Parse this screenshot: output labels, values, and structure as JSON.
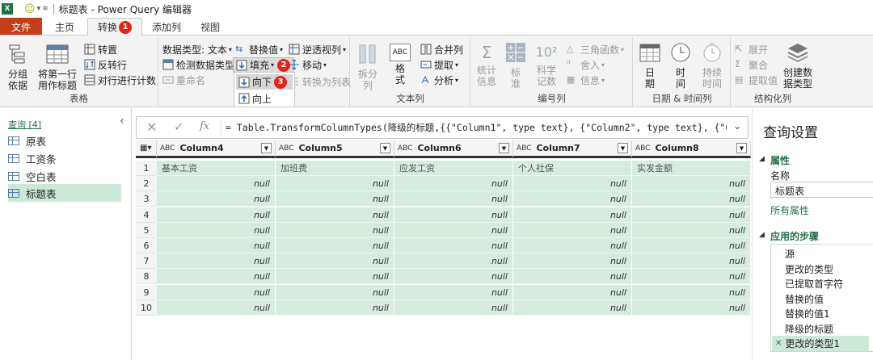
{
  "titlebar": {
    "app_icon": "X",
    "title": "标题表 - Power Query 编辑器"
  },
  "tabs": [
    {
      "label": "文件"
    },
    {
      "label": "主页"
    },
    {
      "label": "转换"
    },
    {
      "label": "添加列"
    },
    {
      "label": "视图"
    }
  ],
  "badges": {
    "b1": "1",
    "b2": "2",
    "b3": "3"
  },
  "ribbon": {
    "table_group": {
      "label": "表格",
      "group_by": "分组\n依据",
      "use_first_row": "将第一行\n用作标题",
      "transpose": "转置",
      "reverse_rows": "反转行",
      "count_rows": "对行进行计数"
    },
    "any_column": {
      "data_type": "数据类型: 文本",
      "detect_type": "检测数据类型",
      "rename": "重命名",
      "replace_values": "替换值",
      "fill": "填充",
      "unpivot": "逆透视列",
      "move": "移动",
      "convert_to_list": "转换为列表"
    },
    "fill_menu": {
      "down": "向下",
      "up": "向上"
    },
    "text_column": {
      "label": "文本列",
      "split": "拆分\n列",
      "format": "格\n式",
      "merge": "合并列",
      "extract": "提取",
      "parse": "分析",
      "abc_icon": "ABC"
    },
    "number_column": {
      "label": "编号列",
      "statistics": "统计\n信息",
      "standard": "标\n准",
      "scientific": "科学\n记数",
      "scientific_icon": "10²",
      "trig": "三角函数",
      "rounding": "舍入",
      "information": "信息"
    },
    "datetime": {
      "label": "日期 & 时间列",
      "date": "日\n期",
      "time": "时\n间",
      "duration": "持续\n时间"
    },
    "structured": {
      "label": "结构化列",
      "expand": "展开",
      "aggregate": "聚合",
      "extract_values": "提取值",
      "create_type": "创建数\n据类型"
    }
  },
  "queries": {
    "header": "查询 [4]",
    "items": [
      {
        "label": "原表"
      },
      {
        "label": "工资条"
      },
      {
        "label": "空白表"
      },
      {
        "label": "标题表"
      }
    ]
  },
  "formula": {
    "text": "= Table.TransformColumnTypes(降级的标题,{{\"Column1\", type text}, {\"Column2\", type text}, {\"Column3\","
  },
  "grid": {
    "abc_label": "ABC",
    "columns": [
      "Column4",
      "Column5",
      "Column6",
      "Column7",
      "Column8"
    ],
    "row_numbers": [
      "1",
      "2",
      "3",
      "4",
      "5",
      "6",
      "7",
      "8",
      "9",
      "10"
    ],
    "first_row": [
      "基本工资",
      "加班费",
      "应发工资",
      "个人社保",
      "实发金额"
    ],
    "null_text": "null"
  },
  "settings": {
    "title": "查询设置",
    "properties": "属性",
    "name_label": "名称",
    "name_value": "标题表",
    "all_properties": "所有属性",
    "applied_steps": "应用的步骤",
    "steps": [
      "源",
      "更改的类型",
      "已提取首字符",
      "替换的值",
      "替换的值1",
      "降级的标题",
      "更改的类型1"
    ]
  },
  "colors": {
    "accent": "#217346",
    "file_tab": "#c43e1c",
    "selection": "#cce8d9",
    "cells": "#d5ecdf",
    "badge": "#e1251b"
  }
}
